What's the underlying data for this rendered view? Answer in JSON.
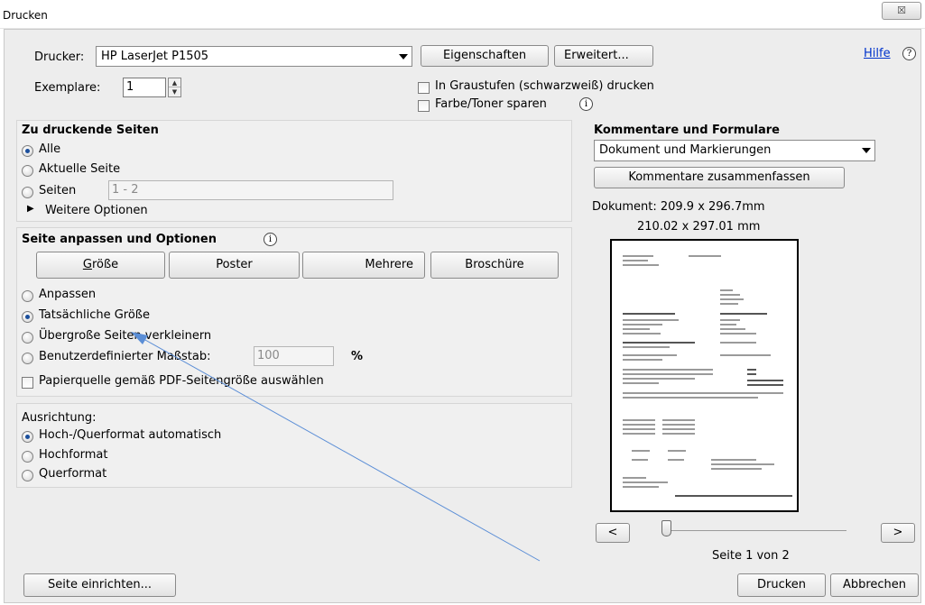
{
  "window": {
    "title": "Drucken",
    "close_glyph": "☒"
  },
  "printer": {
    "label": "Drucker:",
    "selected": "HP LaserJet P1505",
    "properties_button": "Eigenschaften",
    "advanced_button": "Erweitert...",
    "help_link": "Hilfe",
    "copies_label": "Exemplare:",
    "copies_value": "1",
    "grayscale_label": "In Graustufen (schwarzweiß) drucken",
    "grayscale_checked": false,
    "save_toner_label": "Farbe/Toner sparen",
    "save_toner_checked": false
  },
  "pages": {
    "heading": "Zu druckende Seiten",
    "options": [
      {
        "label": "Alle",
        "checked": true
      },
      {
        "label": "Aktuelle Seite",
        "checked": false
      },
      {
        "label": "Seiten",
        "checked": false
      }
    ],
    "range_value": "1 - 2",
    "more_options": "Weitere Optionen"
  },
  "sizing": {
    "heading": "Seite anpassen und Optionen",
    "tabs": [
      {
        "label": "Größe",
        "mnemonic_first": "G",
        "rest": "röße"
      },
      {
        "label": "Poster"
      },
      {
        "label": "Mehrere"
      },
      {
        "label": "Broschüre"
      }
    ],
    "options": [
      {
        "label": "Anpassen",
        "checked": false
      },
      {
        "label": "Tatsächliche Größe",
        "checked": true
      },
      {
        "label": "Übergroße Seiten verkleinern",
        "checked": false
      },
      {
        "label": "Benutzerdefinierter Maßstab:",
        "checked": false
      }
    ],
    "scale_value": "100",
    "scale_unit": "%",
    "paper_source_label": "Papierquelle gemäß PDF-Seitengröße auswählen",
    "paper_source_checked": false
  },
  "orientation": {
    "heading": "Ausrichtung:",
    "options": [
      {
        "label": "Hoch-/Querformat automatisch",
        "checked": true
      },
      {
        "label": "Hochformat",
        "checked": false
      },
      {
        "label": "Querformat",
        "checked": false
      }
    ]
  },
  "comments": {
    "heading": "Kommentare und Formulare",
    "selected": "Dokument und Markierungen",
    "summarize_button": "Kommentare zusammenfassen"
  },
  "preview": {
    "document_size": "Dokument: 209.9 x 296.7mm",
    "paper_size": "210.02 x 297.01 mm",
    "prev_button": "<",
    "next_button": ">",
    "page_indicator": "Seite 1 von 2",
    "slider_position": 0
  },
  "footer": {
    "page_setup_button": "Seite einrichten...",
    "print_button": "Drucken",
    "cancel_button": "Abbrechen"
  },
  "colors": {
    "dialog_bg": "#ededed",
    "link": "#0033cc",
    "radio_dot": "#1b4f9c",
    "annotation_arrow": "#5b8ed6"
  }
}
